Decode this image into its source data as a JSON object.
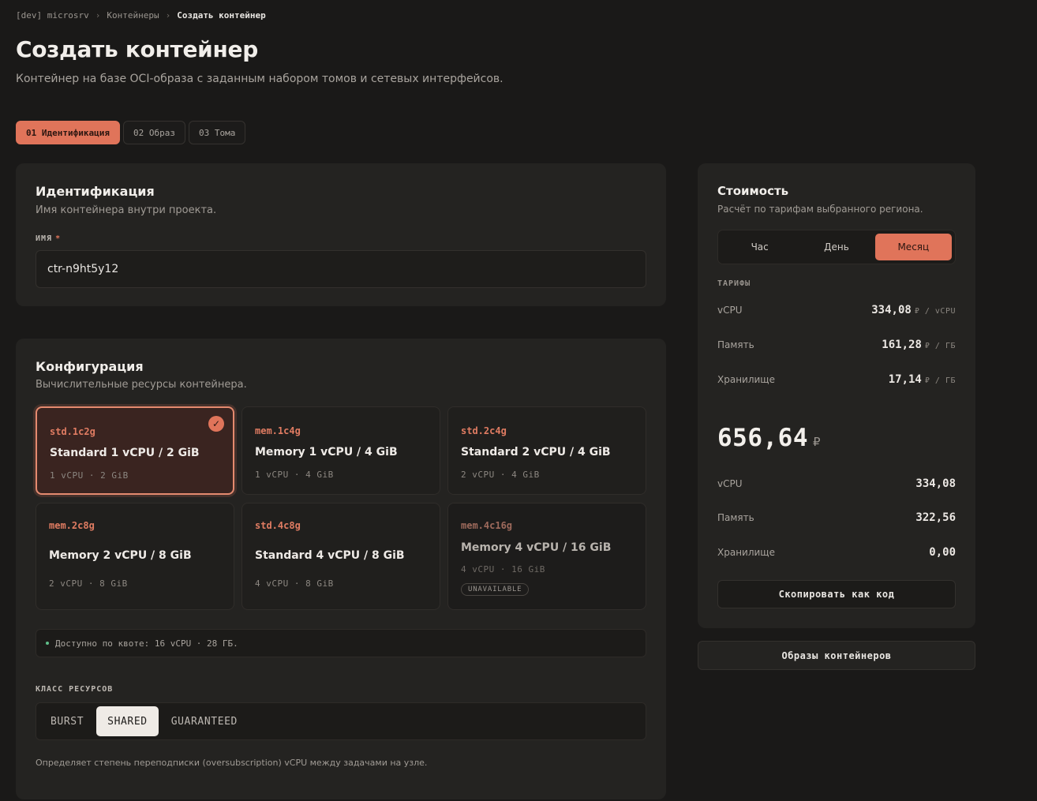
{
  "breadcrumb": {
    "env": "[dev] microsrv",
    "section": "Контейнеры",
    "current": "Создать контейнер",
    "separator": "›"
  },
  "header": {
    "title": "Создать контейнер",
    "subtitle": "Контейнер на базе OCI-образа с заданным набором томов и сетевых интерфейсов."
  },
  "steps": [
    {
      "label": "01 Идентификация",
      "active": true
    },
    {
      "label": "02 Образ",
      "active": false
    },
    {
      "label": "03 Тома",
      "active": false
    }
  ],
  "identification": {
    "title": "Идентификация",
    "subtitle": "Имя контейнера внутри проекта.",
    "name_label": "ИМЯ",
    "required_mark": "*",
    "name_value": "ctr-n9ht5y12"
  },
  "configuration": {
    "title": "Конфигурация",
    "subtitle": "Вычислительные ресурсы контейнера.",
    "flavors": [
      {
        "code": "std.1c2g",
        "name": "Standard 1 vCPU / 2 GiB",
        "specs": "1 vCPU · 2 GiB",
        "selected": true,
        "available": true
      },
      {
        "code": "mem.1c4g",
        "name": "Memory 1 vCPU / 4 GiB",
        "specs": "1 vCPU · 4 GiB",
        "selected": false,
        "available": true
      },
      {
        "code": "std.2c4g",
        "name": "Standard 2 vCPU / 4 GiB",
        "specs": "2 vCPU · 4 GiB",
        "selected": false,
        "available": true
      },
      {
        "code": "mem.2c8g",
        "name": "Memory 2 vCPU / 8 GiB",
        "specs": "2 vCPU · 8 GiB",
        "selected": false,
        "available": true
      },
      {
        "code": "std.4c8g",
        "name": "Standard 4 vCPU / 8 GiB",
        "specs": "4 vCPU · 8 GiB",
        "selected": false,
        "available": true
      },
      {
        "code": "mem.4c16g",
        "name": "Memory 4 vCPU / 16 GiB",
        "specs": "4 vCPU · 16 GiB",
        "selected": false,
        "available": false,
        "badge": "UNAVAILABLE"
      }
    ],
    "check_icon": "✓",
    "quota": "Доступно по квоте: 16 vCPU · 28 ГБ.",
    "class_label": "КЛАСС РЕСУРСОВ",
    "classes": [
      {
        "label": "BURST",
        "active": false
      },
      {
        "label": "SHARED",
        "active": true
      },
      {
        "label": "GUARANTEED",
        "active": false
      }
    ],
    "class_help": "Определяет степень переподписки (oversubscription) vCPU между задачами на узле."
  },
  "cost": {
    "title": "Стоимость",
    "subtitle": "Расчёт по тарифам выбранного региона.",
    "periods": [
      {
        "label": "Час",
        "active": false
      },
      {
        "label": "День",
        "active": false
      },
      {
        "label": "Месяц",
        "active": true
      }
    ],
    "rates_label": "ТАРИФЫ",
    "rates": [
      {
        "label": "vCPU",
        "value": "334,08",
        "unit": "₽ / vCPU"
      },
      {
        "label": "Память",
        "value": "161,28",
        "unit": "₽ / ГБ"
      },
      {
        "label": "Хранилище",
        "value": "17,14",
        "unit": "₽ / ГБ"
      }
    ],
    "total": "656,64",
    "currency": "₽",
    "breakdown": [
      {
        "label": "vCPU",
        "value": "334,08"
      },
      {
        "label": "Память",
        "value": "322,56"
      },
      {
        "label": "Хранилище",
        "value": "0,00"
      }
    ],
    "copy_button": "Скопировать как код"
  },
  "images_button": "Образы контейнеров",
  "colors": {
    "accent": "#e0745a",
    "background": "#1a1918",
    "card": "#242321",
    "quota_dot": "#5fbf8a"
  }
}
